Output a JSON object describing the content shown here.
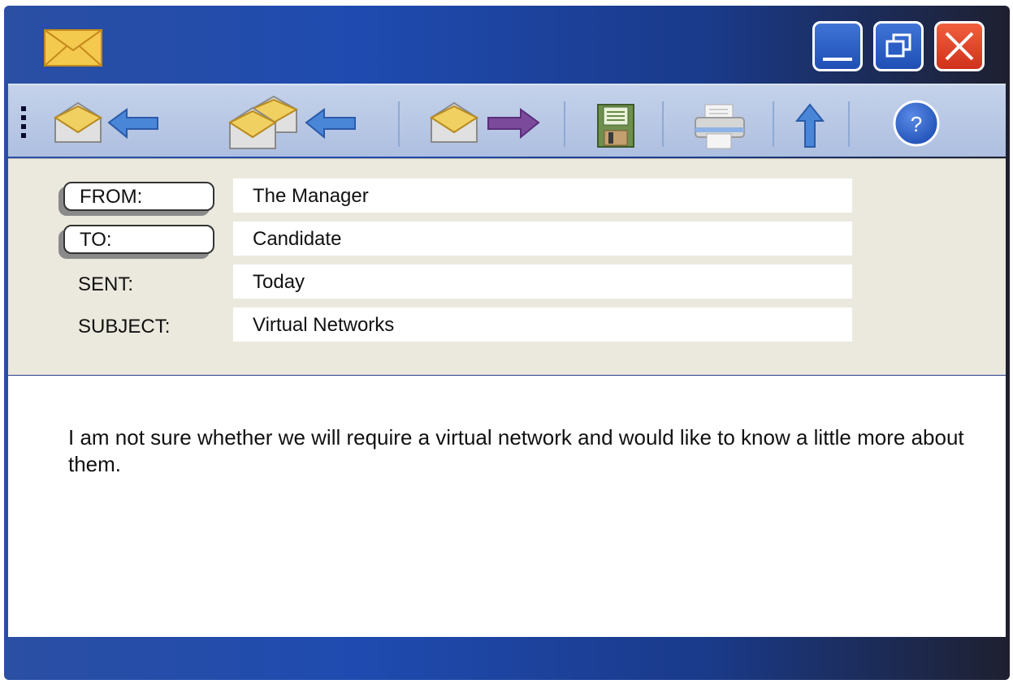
{
  "window": {
    "app_icon": "envelope-icon",
    "controls": {
      "minimize": "minimize-icon",
      "maximize": "restore-icon",
      "close": "close-icon"
    }
  },
  "toolbar": {
    "items": [
      {
        "name": "reply",
        "icon": "reply-icon"
      },
      {
        "name": "reply-all",
        "icon": "reply-all-icon"
      },
      {
        "name": "forward",
        "icon": "forward-icon"
      },
      {
        "name": "save",
        "icon": "save-icon"
      },
      {
        "name": "print",
        "icon": "print-icon"
      },
      {
        "name": "up",
        "icon": "up-arrow-icon"
      },
      {
        "name": "help",
        "icon": "help-icon",
        "label": "?"
      }
    ]
  },
  "header": {
    "from_label": "FROM:",
    "from_value": "The Manager",
    "to_label": "TO:",
    "to_value": "Candidate",
    "sent_label": "SENT:",
    "sent_value": "Today",
    "subject_label": "SUBJECT:",
    "subject_value": "Virtual Networks"
  },
  "message": {
    "body": "I am not sure whether we will require a virtual network and would like to know a little more about them."
  },
  "colors": {
    "title_bar": "#1f4bb0",
    "toolbar": "#b8c8e6",
    "header_bg": "#ebe9dd",
    "close_button": "#e0472b",
    "arrow_blue": "#4a86d8",
    "arrow_purple": "#7b4a9a",
    "help_button": "#2f63d0"
  }
}
